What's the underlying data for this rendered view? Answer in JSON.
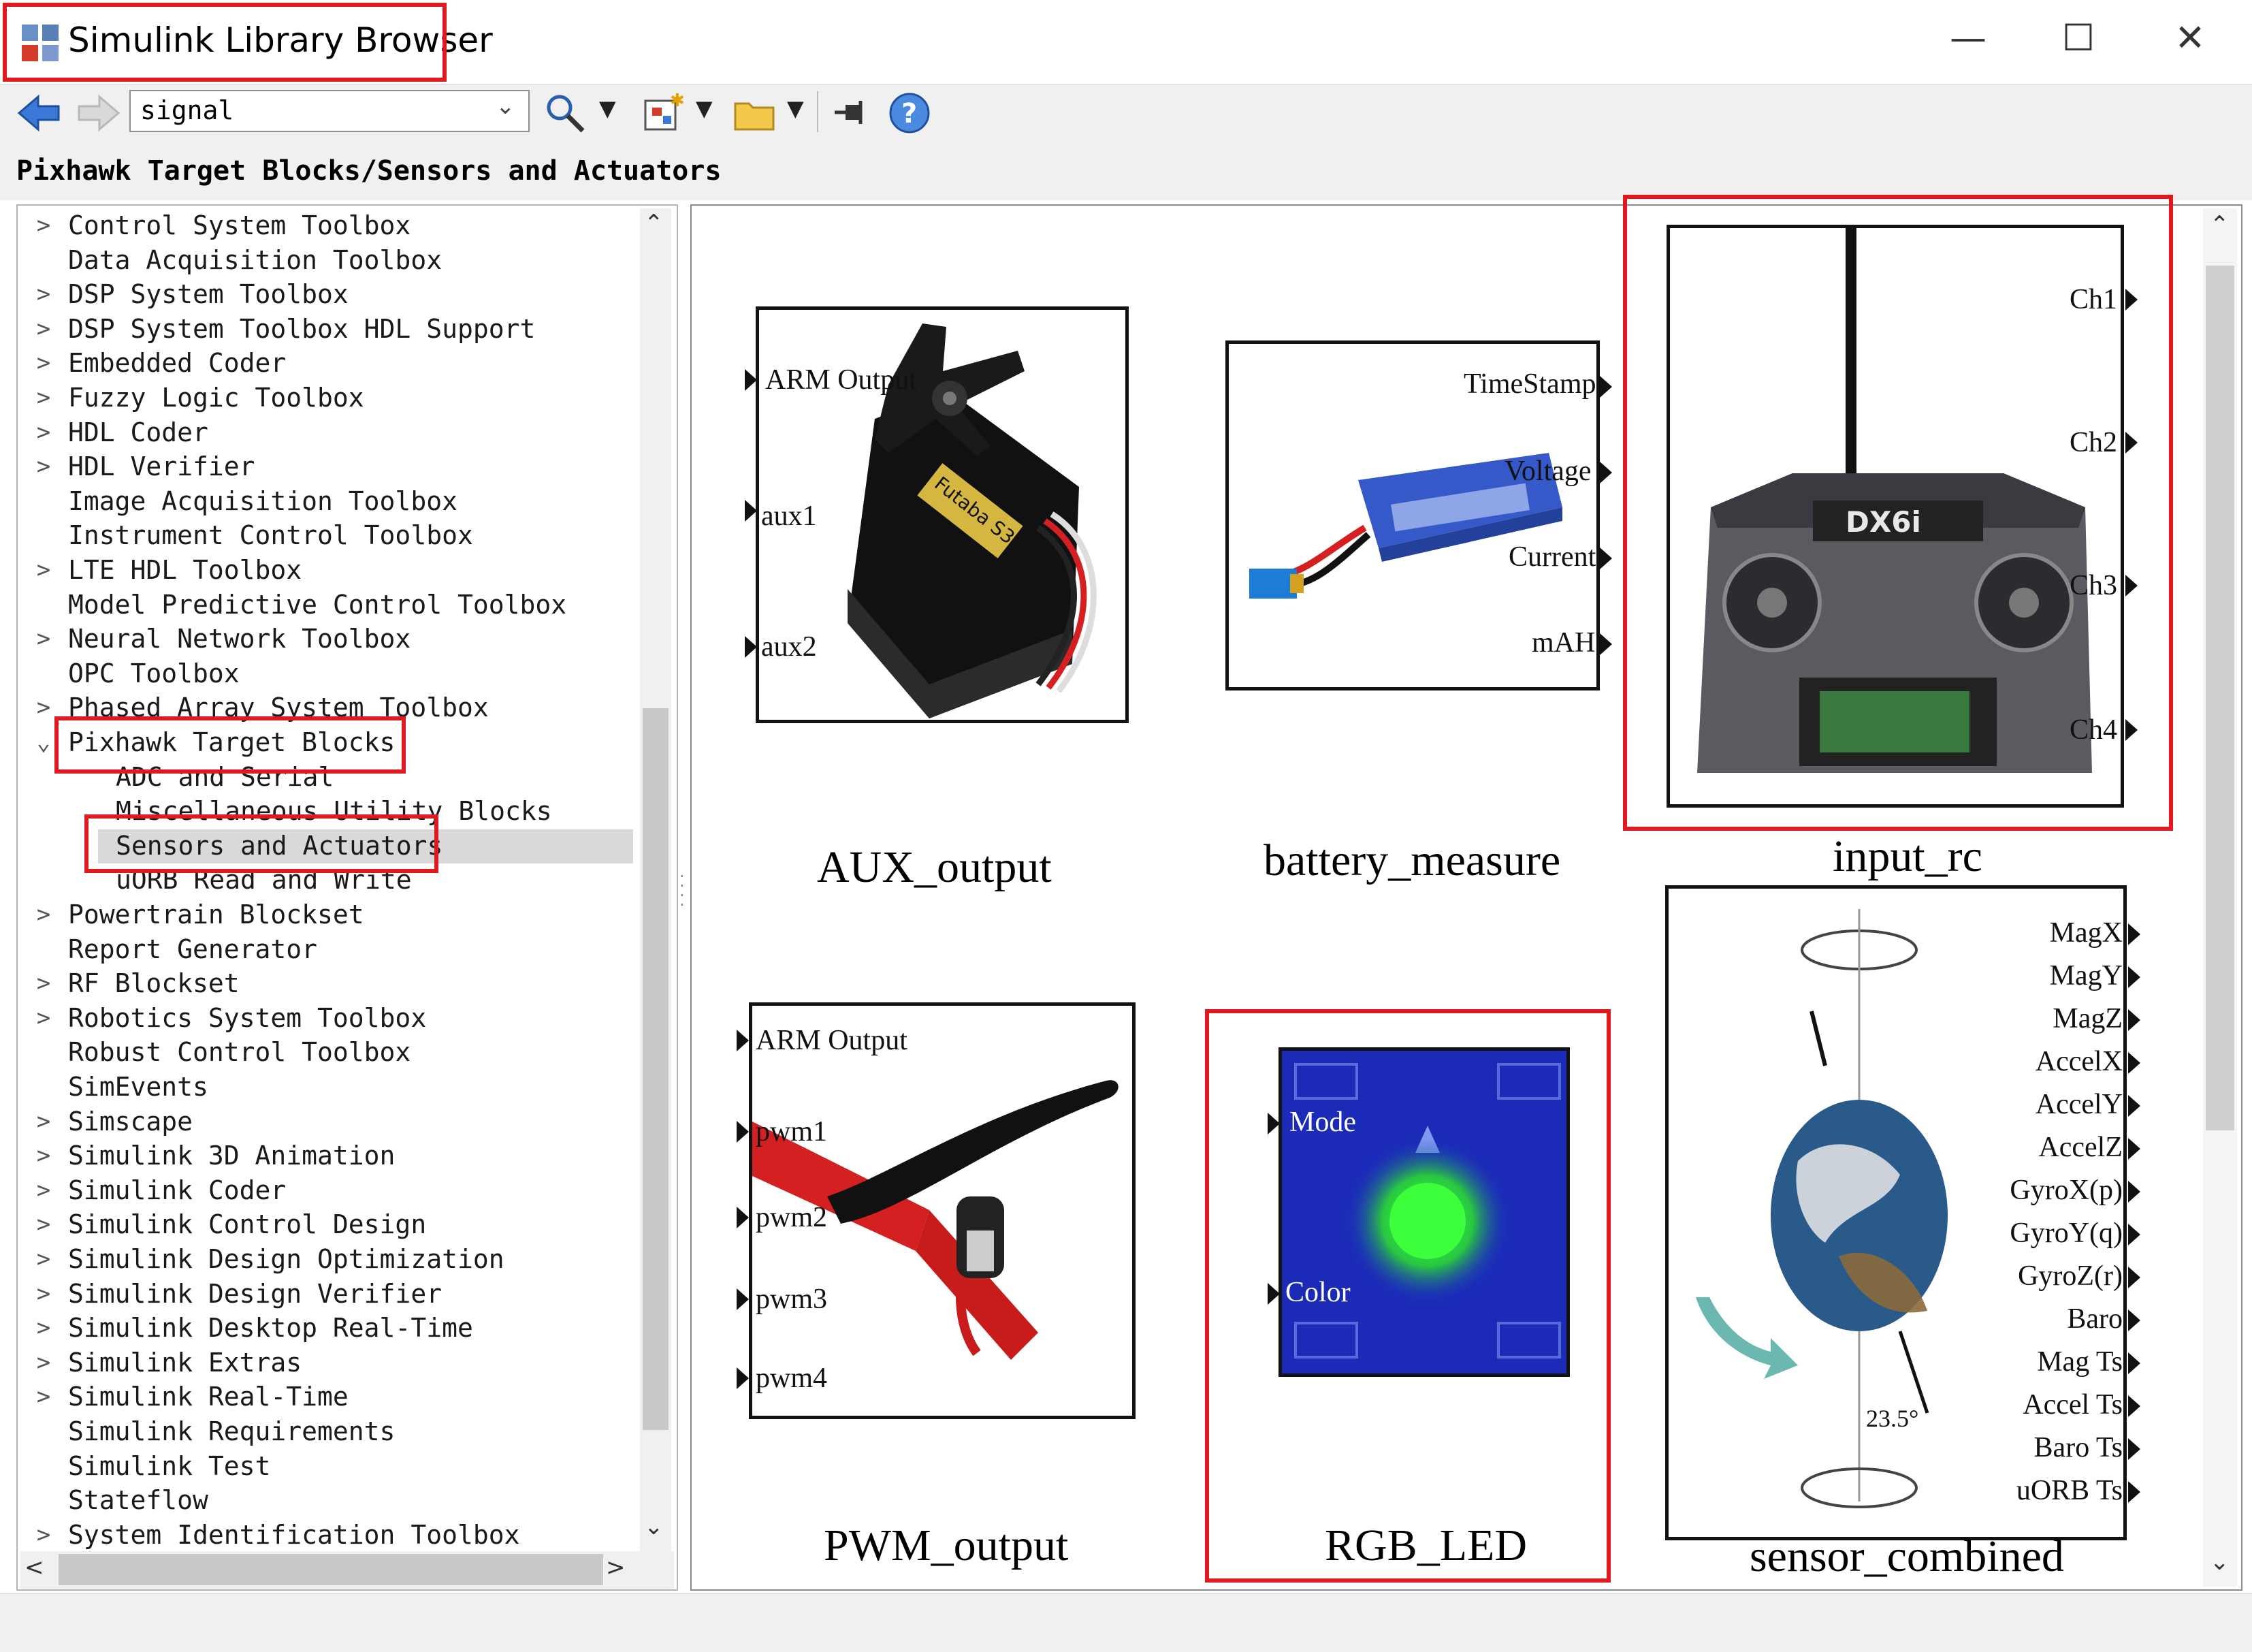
{
  "window": {
    "title": "Simulink Library Browser",
    "minimize": "—",
    "maximize": "☐",
    "close": "✕"
  },
  "toolbar": {
    "search_value": "signal",
    "path": "Pixhawk Target Blocks/Sensors and Actuators"
  },
  "tree": [
    {
      "label": "Control System Toolbox",
      "expander": "collapsed",
      "indent": 0
    },
    {
      "label": "Data Acquisition Toolbox",
      "expander": "none",
      "indent": 0
    },
    {
      "label": "DSP System Toolbox",
      "expander": "collapsed",
      "indent": 0
    },
    {
      "label": "DSP System Toolbox HDL Support",
      "expander": "collapsed",
      "indent": 0
    },
    {
      "label": "Embedded Coder",
      "expander": "collapsed",
      "indent": 0
    },
    {
      "label": "Fuzzy Logic Toolbox",
      "expander": "collapsed",
      "indent": 0
    },
    {
      "label": "HDL Coder",
      "expander": "collapsed",
      "indent": 0
    },
    {
      "label": "HDL Verifier",
      "expander": "collapsed",
      "indent": 0
    },
    {
      "label": "Image Acquisition Toolbox",
      "expander": "none",
      "indent": 0
    },
    {
      "label": "Instrument Control Toolbox",
      "expander": "none",
      "indent": 0
    },
    {
      "label": "LTE HDL Toolbox",
      "expander": "collapsed",
      "indent": 0
    },
    {
      "label": "Model Predictive Control Toolbox",
      "expander": "none",
      "indent": 0
    },
    {
      "label": "Neural Network Toolbox",
      "expander": "collapsed",
      "indent": 0
    },
    {
      "label": "OPC Toolbox",
      "expander": "none",
      "indent": 0
    },
    {
      "label": "Phased Array System Toolbox",
      "expander": "collapsed",
      "indent": 0
    },
    {
      "label": "Pixhawk Target Blocks",
      "expander": "expanded",
      "indent": 0
    },
    {
      "label": "ADC and Serial",
      "expander": "none",
      "indent": 1
    },
    {
      "label": "Miscellaneous Utility Blocks",
      "expander": "none",
      "indent": 1
    },
    {
      "label": "Sensors and Actuators",
      "expander": "none",
      "indent": 1,
      "selected": true
    },
    {
      "label": "uORB Read and Write",
      "expander": "none",
      "indent": 1
    },
    {
      "label": "Powertrain Blockset",
      "expander": "collapsed",
      "indent": 0
    },
    {
      "label": "Report Generator",
      "expander": "none",
      "indent": 0
    },
    {
      "label": "RF Blockset",
      "expander": "collapsed",
      "indent": 0
    },
    {
      "label": "Robotics System Toolbox",
      "expander": "collapsed",
      "indent": 0
    },
    {
      "label": "Robust Control Toolbox",
      "expander": "none",
      "indent": 0
    },
    {
      "label": "SimEvents",
      "expander": "none",
      "indent": 0
    },
    {
      "label": "Simscape",
      "expander": "collapsed",
      "indent": 0
    },
    {
      "label": "Simulink 3D Animation",
      "expander": "collapsed",
      "indent": 0
    },
    {
      "label": "Simulink Coder",
      "expander": "collapsed",
      "indent": 0
    },
    {
      "label": "Simulink Control Design",
      "expander": "collapsed",
      "indent": 0
    },
    {
      "label": "Simulink Design Optimization",
      "expander": "collapsed",
      "indent": 0
    },
    {
      "label": "Simulink Design Verifier",
      "expander": "collapsed",
      "indent": 0
    },
    {
      "label": "Simulink Desktop Real-Time",
      "expander": "collapsed",
      "indent": 0
    },
    {
      "label": "Simulink Extras",
      "expander": "collapsed",
      "indent": 0
    },
    {
      "label": "Simulink Real-Time",
      "expander": "collapsed",
      "indent": 0
    },
    {
      "label": "Simulink Requirements",
      "expander": "none",
      "indent": 0
    },
    {
      "label": "Simulink Test",
      "expander": "none",
      "indent": 0
    },
    {
      "label": "Stateflow",
      "expander": "none",
      "indent": 0
    },
    {
      "label": "System Identification Toolbox",
      "expander": "collapsed",
      "indent": 0
    }
  ],
  "blocks": {
    "aux_output": {
      "name": "AUX_output",
      "inputs": [
        "ARM Output",
        "aux1",
        "aux2"
      ],
      "device": "Futaba S3003"
    },
    "battery_measure": {
      "name": "battery_measure",
      "outputs": [
        "TimeStamp",
        "Voltage",
        "Current",
        "mAH"
      ]
    },
    "input_rc": {
      "name": "input_rc",
      "outputs": [
        "Ch1",
        "Ch2",
        "Ch3",
        "Ch4"
      ],
      "device": "DX6i"
    },
    "pwm_output": {
      "name": "PWM_output",
      "inputs": [
        "ARM Output",
        "pwm1",
        "pwm2",
        "pwm3",
        "pwm4"
      ]
    },
    "rgb_led": {
      "name": "RGB_LED",
      "inputs": [
        "Mode",
        "Color"
      ]
    },
    "sensor_combined": {
      "name": "sensor_combined",
      "outputs": [
        "MagX",
        "MagY",
        "MagZ",
        "AccelX",
        "AccelY",
        "AccelZ",
        "GyroX(p)",
        "GyroY(q)",
        "GyroZ(r)",
        "Baro",
        "Mag Ts",
        "Accel Ts",
        "Baro Ts",
        "uORB Ts"
      ],
      "tilt": "23.5°"
    }
  },
  "colors": {
    "highlight": "#e0191e",
    "selection": "#d9d9d9",
    "led": "#3cff3c"
  }
}
